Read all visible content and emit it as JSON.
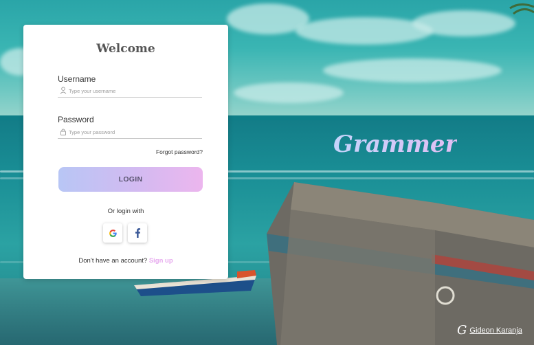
{
  "login": {
    "title": "Welcome",
    "username_label": "Username",
    "username_placeholder": "Type your username",
    "username_value": "",
    "password_label": "Password",
    "password_placeholder": "Type your password",
    "password_value": "",
    "forgot_password": "Forgot password?",
    "login_button": "LOGIN",
    "or_login_with": "Or login with",
    "social_icons": [
      "google-icon",
      "facebook-icon"
    ],
    "no_account_text": "Don’t have an account?",
    "signup_link": "Sign up"
  },
  "brand": {
    "name": "Grammer"
  },
  "credit": {
    "logo_glyph": "G",
    "name": "Gideon Karanja"
  },
  "colors": {
    "login_gradient_start": "#b8c6f5",
    "login_gradient_end": "#ecb6ee",
    "signup_link": "#e6a9ee",
    "card_bg": "#ffffff"
  }
}
